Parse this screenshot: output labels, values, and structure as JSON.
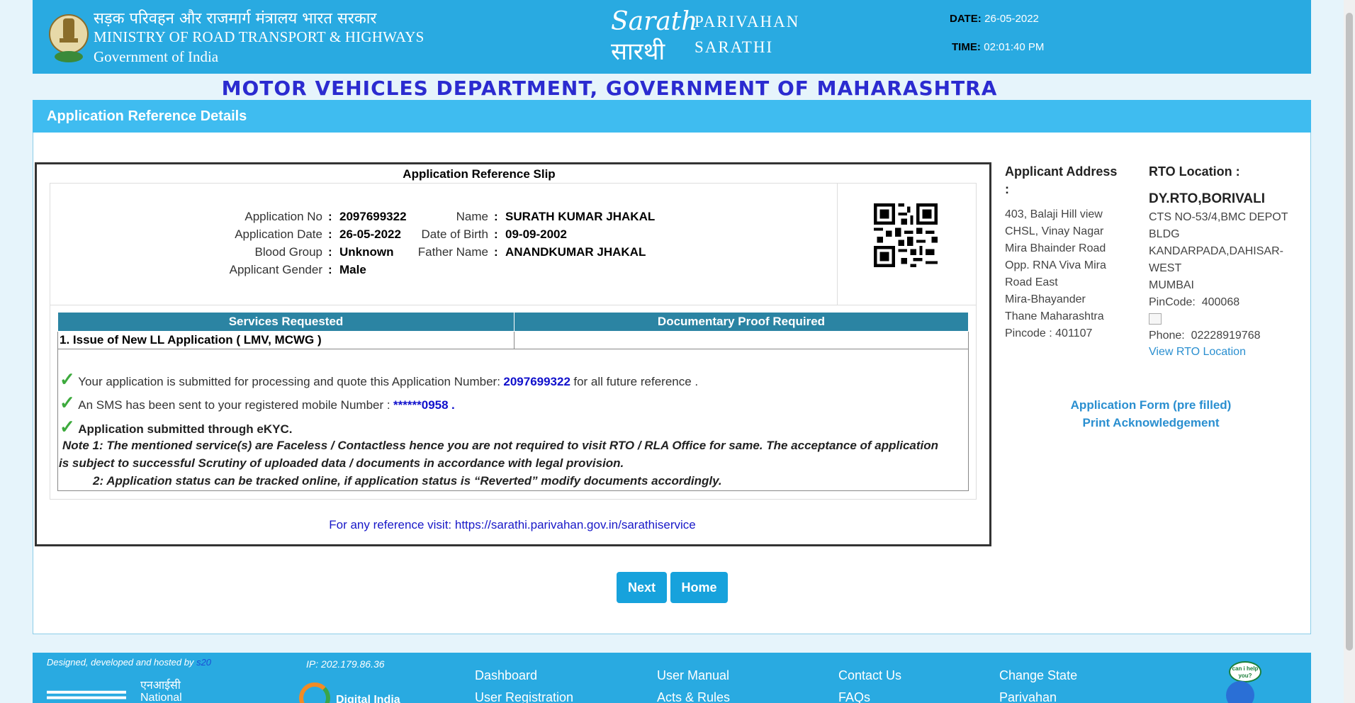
{
  "header": {
    "gov_hindi": "सड़क परिवहन और राजमार्ग मंत्रालय भारत सरकार",
    "gov_english_1": "MINISTRY OF ROAD TRANSPORT & HIGHWAYS",
    "gov_english_2": "Government of India",
    "logo_script": "Sarathi",
    "logo_hindi": "सारथी",
    "brand_1": "PARIVAHAN",
    "brand_2": "SARATHI",
    "date_label": "DATE:",
    "date_value": "26-05-2022",
    "time_label": "TIME:",
    "time_value": "02:01:40 PM"
  },
  "department_title": "MOTOR VEHICLES DEPARTMENT, GOVERNMENT OF MAHARASHTRA",
  "panel_title": "Application Reference Details",
  "slip": {
    "title": "Application Reference Slip",
    "left_fields": [
      {
        "label": "Application No",
        "value": "2097699322"
      },
      {
        "label": "Application Date",
        "value": "26-05-2022"
      },
      {
        "label": "Blood Group",
        "value": "Unknown"
      },
      {
        "label": "Applicant Gender",
        "value": "Male"
      }
    ],
    "right_fields": [
      {
        "label": "Name",
        "value": "SURATH KUMAR JHAKAL"
      },
      {
        "label": "Date of Birth",
        "value": "09-09-2002"
      },
      {
        "label": "Father Name",
        "value": "ANANDKUMAR JHAKAL"
      }
    ],
    "table_headers": [
      "Services Requested",
      "Documentary Proof Required"
    ],
    "table_rows": [
      [
        "1. Issue of New LL Application ( LMV, MCWG )",
        ""
      ]
    ],
    "msg1_pre": "Your application is submitted for processing and quote this Application Number:",
    "msg1_number": "2097699322",
    "msg1_post": "for all future reference .",
    "msg2_pre": "An SMS has been sent to your registered mobile Number :",
    "msg2_number": "******0958",
    "msg2_post": ".",
    "msg3": "Application submitted through eKYC.",
    "note1_line1": "Note 1:  The mentioned service(s) are Faceless / Contactless hence you are not required to visit RTO / RLA Office for same. The acceptance of application",
    "note1_line2": "is subject to successful Scrutiny of uploaded data / documents in accordance with legal provision.",
    "note2": "2:  Application status can be tracked online, if application status is “Reverted” modify documents accordingly.",
    "reference_line": "For any reference visit: https://sarathi.parivahan.gov.in/sarathiservice"
  },
  "applicant_address": {
    "title_1": "Applicant Address",
    "title_2": ":",
    "lines": [
      "403, Balaji Hill view",
      "CHSL, Vinay Nagar",
      "Mira Bhainder Road",
      "Opp. RNA Viva Mira",
      "Road East",
      "Mira-Bhayander",
      "Thane Maharashtra",
      "Pincode : 401107"
    ]
  },
  "rto": {
    "title": "RTO Location :",
    "name": "DY.RTO,BORIVALI",
    "lines": [
      "CTS NO-53/4,BMC DEPOT",
      "BLDG",
      "KANDARPADA,DAHISAR-",
      "WEST",
      "MUMBAI"
    ],
    "pincode_label": "PinCode:",
    "pincode": "400068",
    "phone_label": "Phone:",
    "phone": "02228919768",
    "view_link": "View RTO Location"
  },
  "links": {
    "application_form": "Application Form (pre filled)",
    "print_ack": "Print Acknowledgement"
  },
  "buttons": {
    "next": "Next",
    "home": "Home"
  },
  "footer": {
    "designed_by": "Designed, developed and hosted by",
    "designed_by_link": "s20",
    "ip": "IP: 202.179.86.36",
    "nic_hindi": "एनआईसी",
    "nic_english": "National",
    "digital_india": "Digital India",
    "help_badge": "can i help you?",
    "nav": [
      [
        "Dashboard",
        "User Registration"
      ],
      [
        "User Manual",
        "Acts & Rules"
      ],
      [
        "Contact Us",
        "FAQs"
      ],
      [
        "Change State",
        "Parivahan"
      ]
    ]
  },
  "colors": {
    "header_blue": "#29aae1",
    "panel_head_blue": "#3fbcf0",
    "title_blue": "#2b2bd0",
    "table_head": "#2b84a3",
    "button": "#17a2dc"
  }
}
